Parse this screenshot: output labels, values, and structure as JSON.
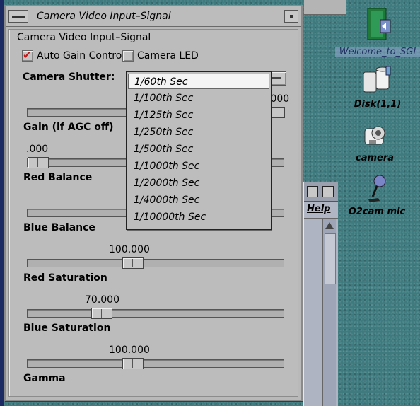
{
  "window": {
    "title": "Camera Video Input–Signal"
  },
  "panel": {
    "heading": "Camera Video Input–Signal",
    "checkboxes": [
      {
        "label": "Auto Gain Control",
        "checked": true
      },
      {
        "label": "Camera LED",
        "checked": false
      }
    ],
    "shutter_label": "Camera Shutter:"
  },
  "dropdown": {
    "selected_index": 0,
    "options": [
      "1/60th Sec",
      "1/100th Sec",
      "1/125th Sec",
      "1/250th Sec",
      "1/500th Sec",
      "1/1000th Sec",
      "1/2000th Sec",
      "1/4000th Sec",
      "1/10000th Sec"
    ]
  },
  "sliders": [
    {
      "label": "Gain (if AGC off)",
      "value_text": ".000",
      "fraction": 1.0
    },
    {
      "label": "Red Balance",
      "value_text": ".000",
      "fraction": 0.0
    },
    {
      "label": "Blue Balance",
      "value_text": "",
      "fraction": 0.6
    },
    {
      "label": "Red Saturation",
      "value_text": "100.000",
      "fraction": 0.4
    },
    {
      "label": "Blue Saturation",
      "value_text": "70.000",
      "fraction": 0.27
    },
    {
      "label": "Gamma",
      "value_text": "100.000",
      "fraction": 0.4
    }
  ],
  "desktop_icons": [
    {
      "label": "Welcome_to_SGI",
      "icon": "welcome-book-icon"
    },
    {
      "label": "Disk(1,1)",
      "icon": "disk-drives-icon"
    },
    {
      "label": "camera",
      "icon": "camera-icon"
    },
    {
      "label": "O2cam mic",
      "icon": "microphone-icon"
    }
  ],
  "background_window": {
    "menu_label": "Help"
  }
}
